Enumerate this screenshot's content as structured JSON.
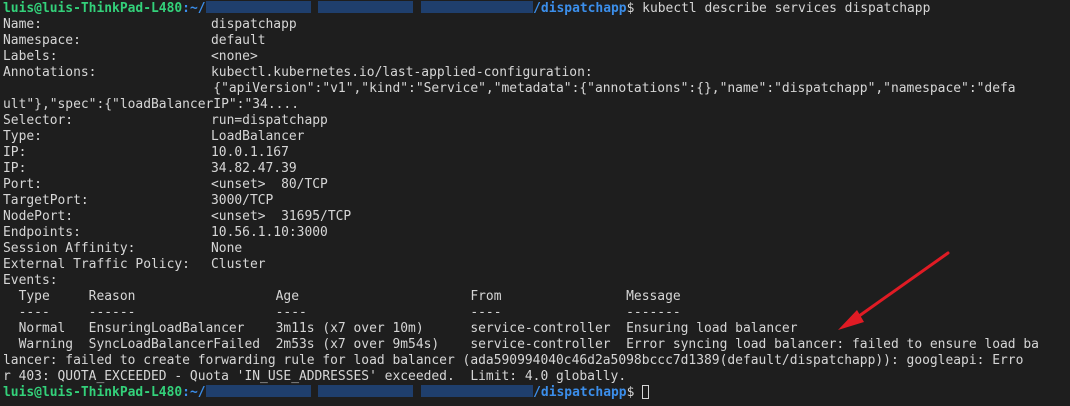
{
  "prompt": {
    "user_host": "luis@luis-ThinkPad-L480",
    "sep": ":~/",
    "dir": "/dispatchapp",
    "dollar": "$ "
  },
  "command": "kubectl describe services dispatchapp",
  "fields": [
    {
      "k": "Name:",
      "v": "dispatchapp"
    },
    {
      "k": "Namespace:",
      "v": "default"
    },
    {
      "k": "Labels:",
      "v": "<none>"
    },
    {
      "k": "Annotations:",
      "v": "kubectl.kubernetes.io/last-applied-configuration:"
    }
  ],
  "annotation_json_1": "                           {\"apiVersion\":\"v1\",\"kind\":\"Service\",\"metadata\":{\"annotations\":{},\"name\":\"dispatchapp\",\"namespace\":\"defa",
  "annotation_json_2": "ult\"},\"spec\":{\"loadBalancerIP\":\"34....",
  "fields2": [
    {
      "k": "Selector:",
      "v": "run=dispatchapp"
    },
    {
      "k": "Type:",
      "v": "LoadBalancer"
    },
    {
      "k": "IP:",
      "v": "10.0.1.167"
    },
    {
      "k": "IP:",
      "v": "34.82.47.39"
    },
    {
      "k": "Port:",
      "v": "<unset>  80/TCP"
    },
    {
      "k": "TargetPort:",
      "v": "3000/TCP"
    },
    {
      "k": "NodePort:",
      "v": "<unset>  31695/TCP"
    },
    {
      "k": "Endpoints:",
      "v": "10.56.1.10:3000"
    },
    {
      "k": "Session Affinity:",
      "v": "None"
    },
    {
      "k": "External Traffic Policy:",
      "v": "Cluster"
    }
  ],
  "events_label": "Events:",
  "events_header": "  Type     Reason                  Age                      From                Message",
  "events_rule": "  ----     ------                  ----                     ----                -------",
  "event_rows": [
    "  Normal   EnsuringLoadBalancer    3m11s (x7 over 10m)      service-controller  Ensuring load balancer",
    "  Warning  SyncLoadBalancerFailed  2m53s (x7 over 9m54s)    service-controller  Error syncing load balancer: failed to ensure load ba",
    "lancer: failed to create forwarding rule for load balancer (ada590994040c46d2a5098bccc7d1389(default/dispatchapp)): googleapi: Erro",
    "r 403: QUOTA_EXCEEDED - Quota 'IN_USE_ADDRESSES' exceeded.  Limit: 4.0 globally."
  ],
  "colors": {
    "background": "#1e1e1e",
    "text": "#d6d6d6",
    "prompt_user": "#33d17a",
    "prompt_path": "#3b8eea",
    "redaction": "#1f3f6d",
    "annotation_arrow": "#e01b24"
  },
  "icons": [
    "annotation-arrow",
    "text-cursor"
  ]
}
